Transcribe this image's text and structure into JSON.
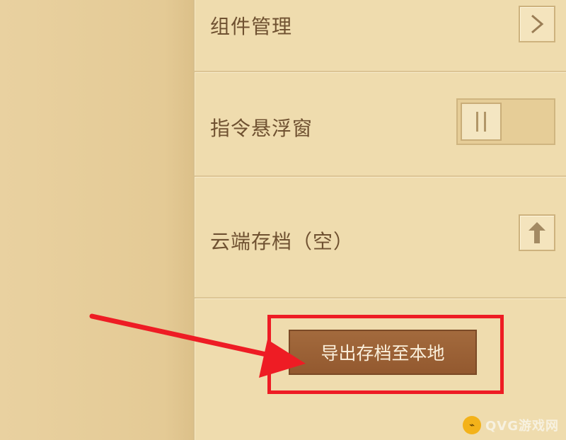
{
  "settings": {
    "component_management": {
      "label": "组件管理",
      "icon": "chevron-right-icon"
    },
    "floating_command_window": {
      "label": "指令悬浮窗",
      "toggle_state": "off"
    },
    "cloud_save": {
      "label": "云端存档（空）",
      "icon": "upload-arrow-icon"
    },
    "export_button": {
      "label": "导出存档至本地"
    }
  },
  "annotation": {
    "highlight_color": "#ee1c24",
    "arrow_color": "#ee1c24"
  },
  "watermark": {
    "text": "QVG游戏网"
  },
  "colors": {
    "panel_bg": "#efdcae",
    "button_bg": "#9a6035",
    "text": "#6f5131"
  }
}
